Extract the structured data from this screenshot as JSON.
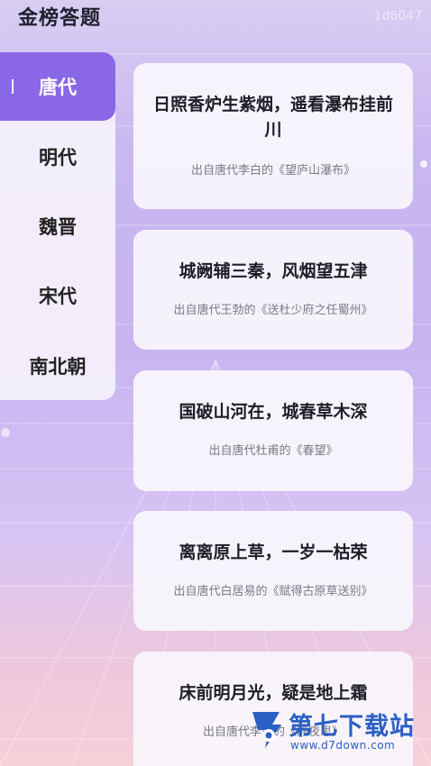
{
  "app": {
    "title": "金榜答题",
    "top_watermark": "1d6047"
  },
  "sidebar": {
    "items": [
      {
        "label": "唐代",
        "active": true
      },
      {
        "label": "明代",
        "active": false
      },
      {
        "label": "魏晋",
        "active": false
      },
      {
        "label": "宋代",
        "active": false
      },
      {
        "label": "南北朝",
        "active": false
      }
    ]
  },
  "cards": [
    {
      "verse": "日照香炉生紫烟，遥看瀑布挂前川",
      "source": "出自唐代李白的《望庐山瀑布》"
    },
    {
      "verse": "城阙辅三秦，风烟望五津",
      "source": "出自唐代王勃的《送杜少府之任蜀州》"
    },
    {
      "verse": "国破山河在，城春草木深",
      "source": "出自唐代杜甫的《春望》"
    },
    {
      "verse": "离离原上草，一岁一枯荣",
      "source": "出自唐代白居易的《赋得古原草送别》"
    },
    {
      "verse": "床前明月光，疑是地上霜",
      "source": "出自唐代李白的《静夜思》"
    }
  ],
  "watermark": {
    "name": "第七下载站",
    "url": "www.d7down.com"
  },
  "colors": {
    "accent": "#8a67e6",
    "brand": "#2a5fc4"
  }
}
